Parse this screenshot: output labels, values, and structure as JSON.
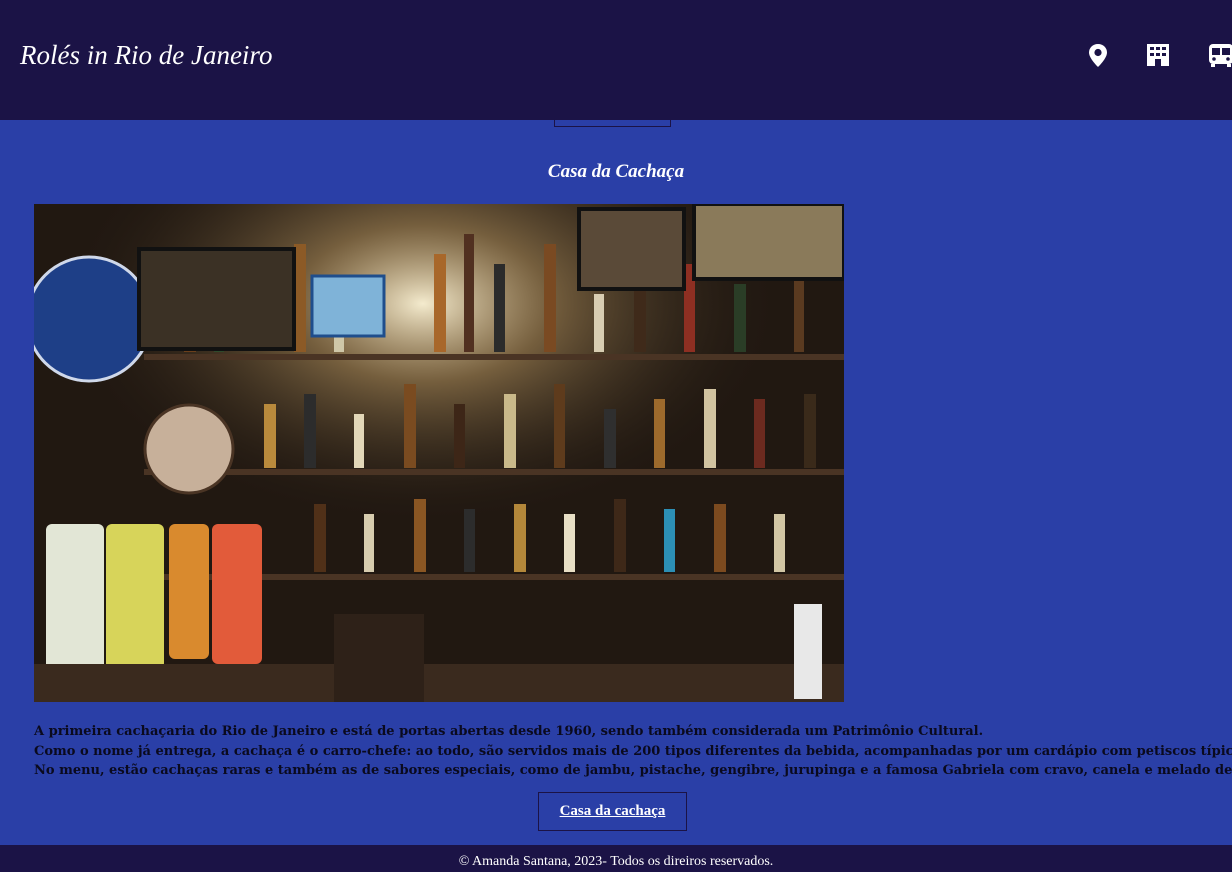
{
  "header": {
    "title": "Rolés in Rio de Janeiro",
    "nav_icons": [
      "map-pin-icon",
      "building-icon",
      "bus-icon"
    ]
  },
  "section": {
    "heading": "Casa da Cachaça",
    "image_alt": "Casa da Cachaça",
    "description_lines": [
      "A primeira cachaçaria do Rio de Janeiro e está de portas abertas desde 1960, sendo também considerada um Patrimônio Cultural.",
      "Como o nome já entrega, a cachaça é o carro-chefe: ao todo, são servidos mais de 200 tipos diferentes da bebida, acompanhadas por um cardápio com petiscos típicos.",
      "No menu, estão cachaças raras e também as de sabores especiais, como de jambu, pistache, gengibre, jurupinga e a famosa Gabriela com cravo, canela e melado de cana."
    ],
    "link_label": "Casa da cachaça"
  },
  "footer": {
    "text": "© Amanda Santana, 2023- Todos os direiros reservados."
  },
  "colors": {
    "header_bg": "#1b1346",
    "page_bg": "#2a3fa7",
    "text_light": "#ffffff"
  }
}
